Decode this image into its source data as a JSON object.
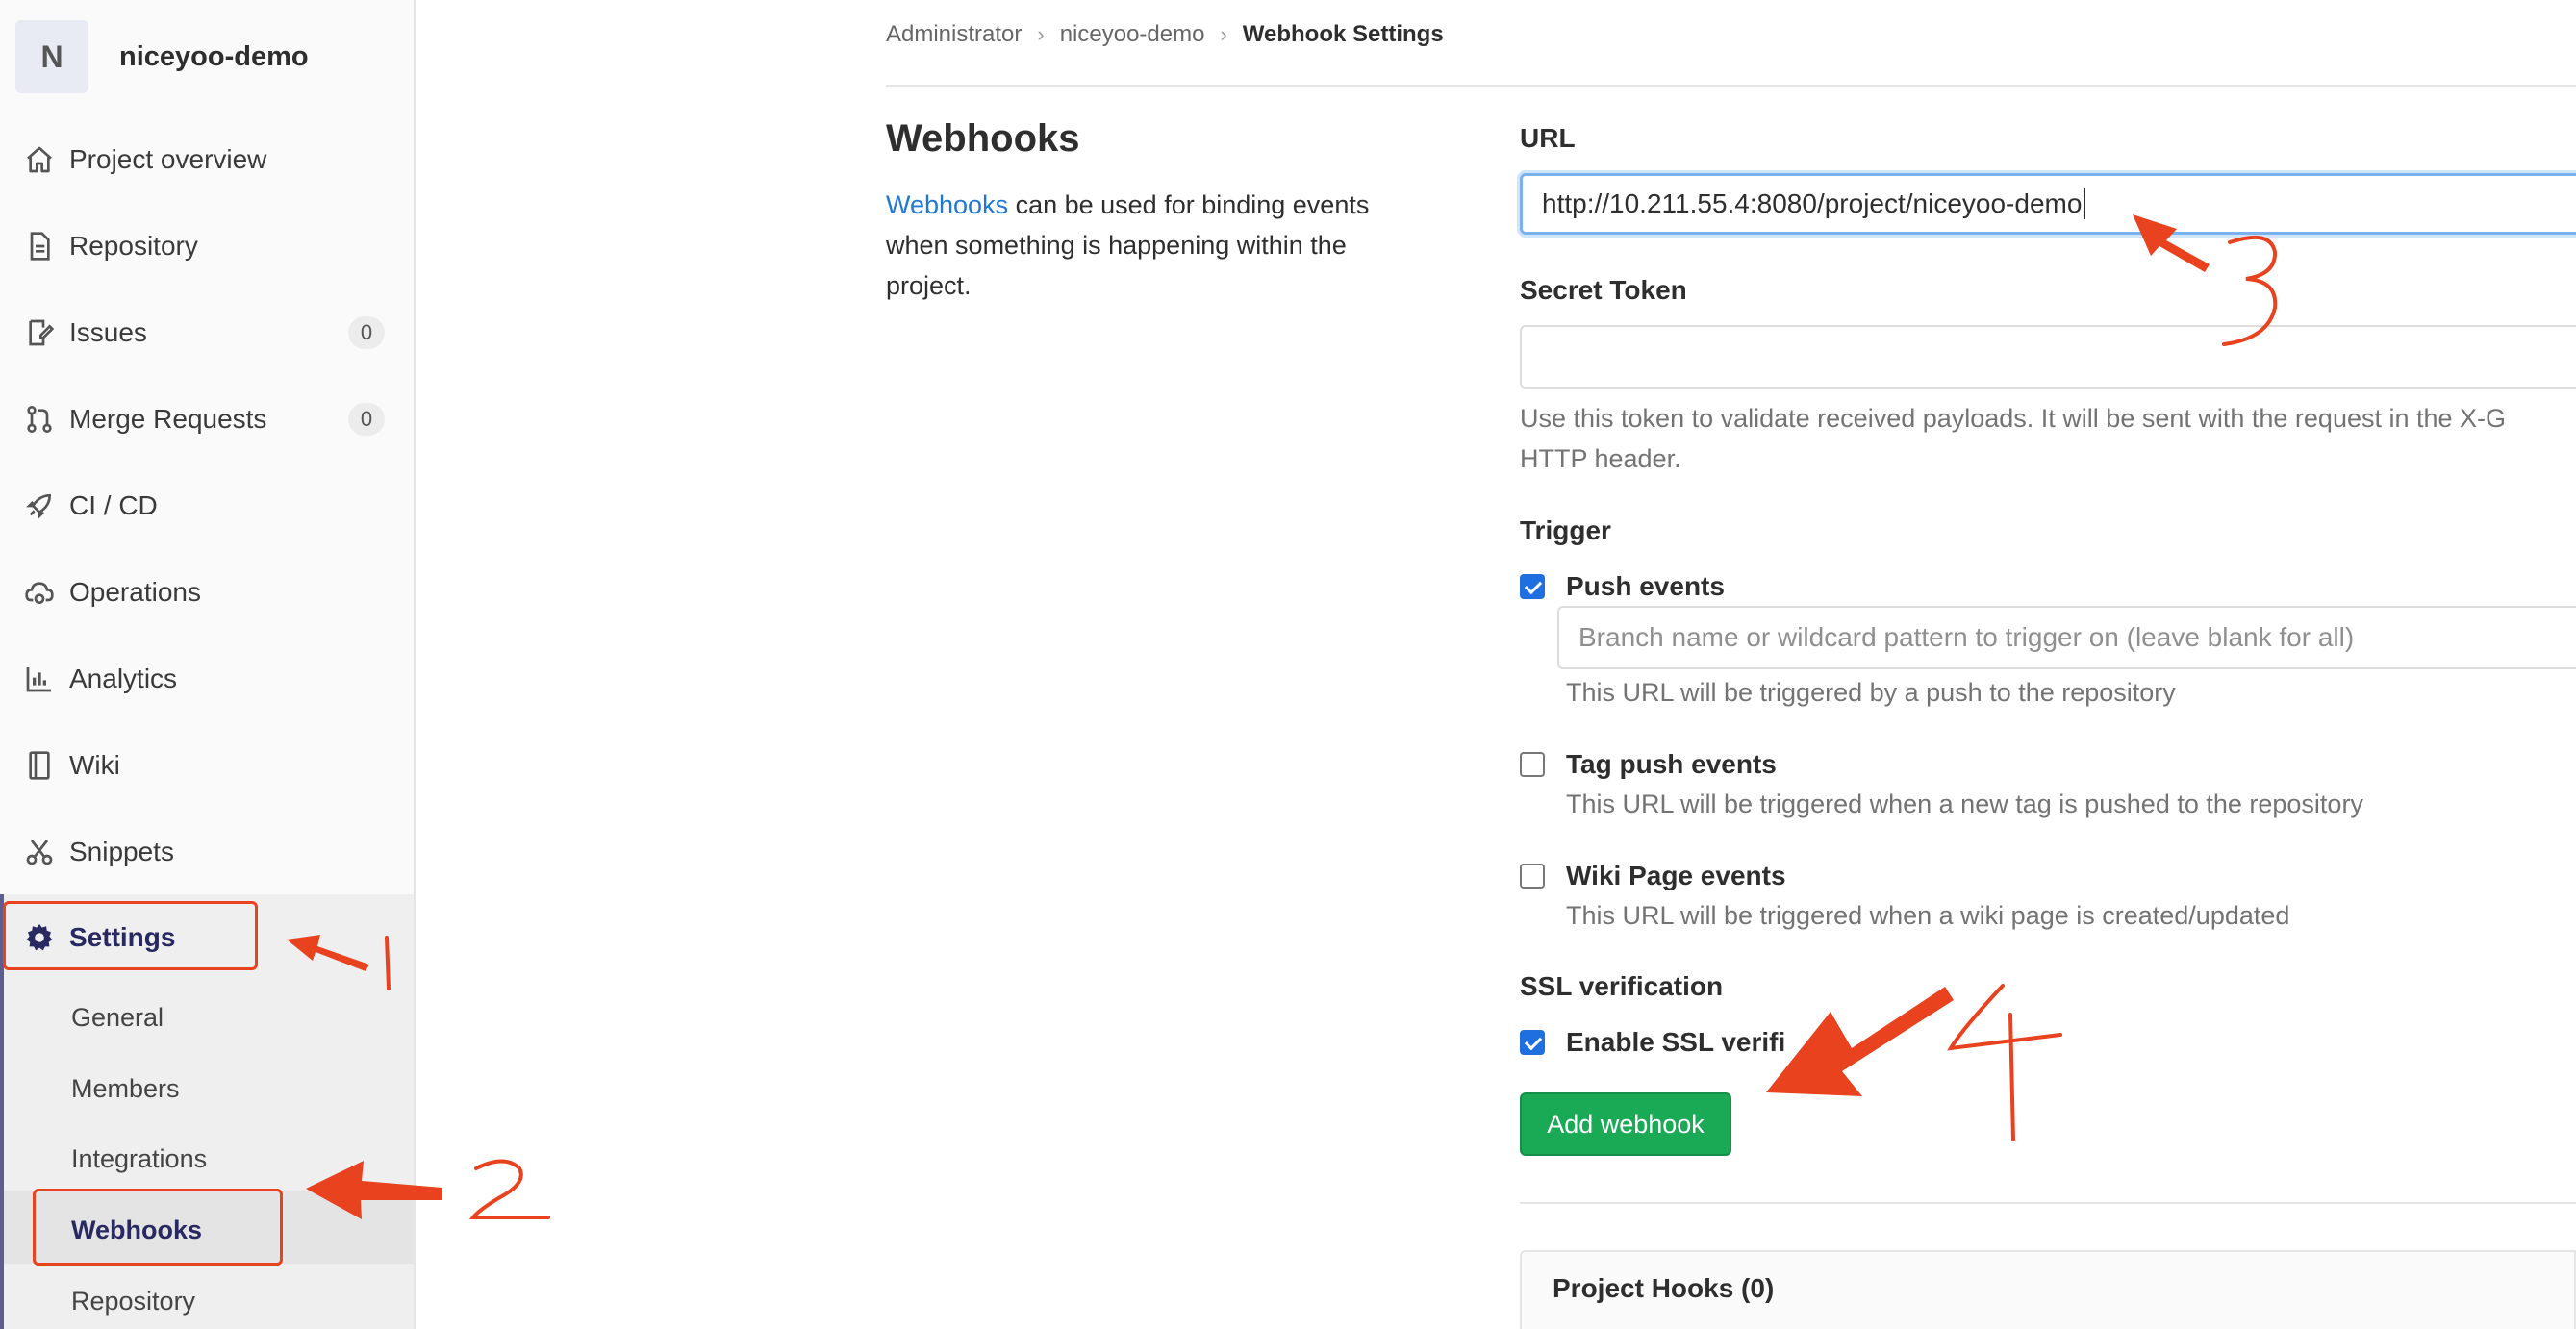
{
  "sidebar": {
    "project_initial": "N",
    "project_name": "niceyoo-demo",
    "items": [
      {
        "label": "Project overview",
        "icon": "home-icon"
      },
      {
        "label": "Repository",
        "icon": "document-icon"
      },
      {
        "label": "Issues",
        "icon": "issues-icon",
        "count": "0"
      },
      {
        "label": "Merge Requests",
        "icon": "merge-request-icon",
        "count": "0"
      },
      {
        "label": "CI / CD",
        "icon": "rocket-icon"
      },
      {
        "label": "Operations",
        "icon": "cloud-gear-icon"
      },
      {
        "label": "Analytics",
        "icon": "chart-icon"
      },
      {
        "label": "Wiki",
        "icon": "book-icon"
      },
      {
        "label": "Snippets",
        "icon": "scissors-icon"
      },
      {
        "label": "Settings",
        "icon": "gear-icon"
      }
    ],
    "settings_sub": [
      "General",
      "Members",
      "Integrations",
      "Webhooks",
      "Repository"
    ]
  },
  "breadcrumb": [
    "Administrator",
    "niceyoo-demo",
    "Webhook Settings"
  ],
  "intro": {
    "title": "Webhooks",
    "link_text": "Webhooks",
    "text": " can be used for binding events when something is happening within the project."
  },
  "form": {
    "url_label": "URL",
    "url_value": "http://10.211.55.4:8080/project/niceyoo-demo",
    "secret_label": "Secret Token",
    "secret_value": "",
    "secret_help": "Use this token to validate received payloads. It will be sent with the request in the X-G HTTP header.",
    "trigger_label": "Trigger",
    "push_label": "Push events",
    "push_checked": true,
    "branch_placeholder": "Branch name or wildcard pattern to trigger on (leave blank for all)",
    "push_help": "This URL will be triggered by a push to the repository",
    "tag_label": "Tag push events",
    "tag_checked": false,
    "tag_help": "This URL will be triggered when a new tag is pushed to the repository",
    "wiki_label": "Wiki Page events",
    "wiki_checked": false,
    "wiki_help": "This URL will be triggered when a wiki page is created/updated",
    "ssl_label": "SSL verification",
    "ssl_check_label": "Enable SSL verifi",
    "ssl_checked": true,
    "submit_label": "Add webhook"
  },
  "project_hooks_title": "Project Hooks (0)",
  "annotations": {
    "color": "#e8421f",
    "numbers": [
      "1",
      "2",
      "3",
      "4"
    ]
  }
}
